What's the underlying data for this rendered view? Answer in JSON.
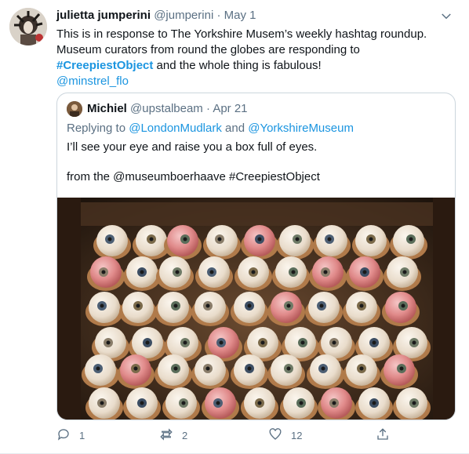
{
  "tweet": {
    "author_name": "julietta jumperini",
    "handle": "@jumperini",
    "separator": "·",
    "date": "May 1",
    "text_part1": "This is in response to The Yorkshire Musem’s weekly hashtag roundup. Museum curators from round the globes are responding to ",
    "hashtag": "#CreepiestObject",
    "text_part2": " and the whole thing is fabulous!",
    "mention": "@minstrel_flo"
  },
  "quoted": {
    "author_name": "Michiel",
    "handle": "@upstalbeam",
    "separator": "·",
    "date": "Apr 21",
    "replying_label": "Replying to ",
    "replying_to_1": "@LondonMudlark",
    "replying_and": " and ",
    "replying_to_2": "@YorkshireMuseum",
    "text": "I’ll see your eye and raise you a box full of eyes.",
    "text2": "from the @museumboerhaave #CreepiestObject"
  },
  "actions": {
    "reply_count": "1",
    "retweet_count": "2",
    "like_count": "12"
  },
  "icons": {
    "caret": "chevron-down-icon",
    "reply": "reply-icon",
    "retweet": "retweet-icon",
    "like": "heart-icon",
    "share": "share-icon"
  },
  "colors": {
    "link": "#1b95e0",
    "muted": "#5b7083",
    "border": "#ccd6dd"
  }
}
